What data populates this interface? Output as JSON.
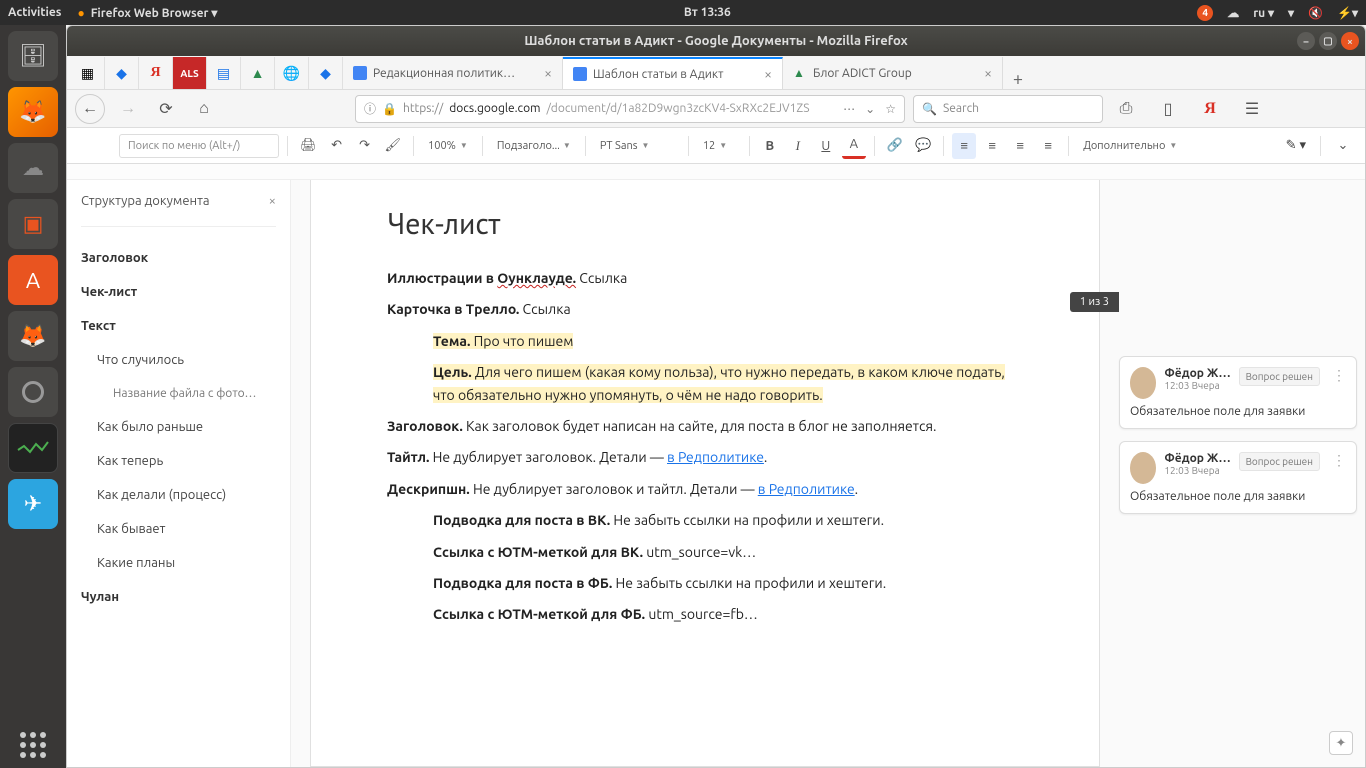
{
  "ubuntu": {
    "activities": "Activities",
    "app_menu": "Firefox Web Browser ▾",
    "clock": "Вт 13:36",
    "notif_count": "4",
    "lang": "ru ▾"
  },
  "launcher": {
    "items": [
      "Files",
      "Firefox",
      "Nextcloud",
      "Sublime Text",
      "Ubuntu Software",
      "GIMP",
      "Settings",
      "System Monitor",
      "Telegram"
    ]
  },
  "window": {
    "title": "Шаблон статьи в Адикт - Google Документы - Mozilla Firefox"
  },
  "tabs": {
    "pinned_count": 8,
    "items": [
      {
        "label": "Редакционная политик…",
        "active": false,
        "icon": "docs"
      },
      {
        "label": "Шаблон статьи в Адикт",
        "active": true,
        "icon": "docs"
      },
      {
        "label": "Блог ADICT Group",
        "active": false,
        "icon": "adict"
      }
    ]
  },
  "url": {
    "proto": "https://",
    "host": "docs.google.com",
    "path": "/document/d/1a82D9wgn3zcKV4-SxRXc2EJV1ZS"
  },
  "search": {
    "placeholder": "Search"
  },
  "toolbar": {
    "menu_search": "Поиск по меню (Alt+/)",
    "zoom": "100%",
    "style": "Подзаголо...",
    "font": "PT Sans",
    "size": "12",
    "more": "Дополнительно"
  },
  "outline": {
    "title": "Структура документа",
    "items": [
      {
        "t": "Заголовок",
        "lvl": "h1"
      },
      {
        "t": "Чек-лист",
        "lvl": "h2"
      },
      {
        "t": "Текст",
        "lvl": "h2"
      },
      {
        "t": "Что случилось",
        "lvl": "h3"
      },
      {
        "t": "Название файла с фото…",
        "lvl": "h4"
      },
      {
        "t": "Как было раньше",
        "lvl": "h3"
      },
      {
        "t": "Как теперь",
        "lvl": "h3"
      },
      {
        "t": "Как делали (процесс)",
        "lvl": "h3"
      },
      {
        "t": "Как бывает",
        "lvl": "h3"
      },
      {
        "t": "Какие планы",
        "lvl": "h3"
      },
      {
        "t": "Чулан",
        "lvl": "h2"
      }
    ]
  },
  "doc": {
    "heading": "Чек-лист",
    "p1_b": "Иллюстрации в ",
    "p1_link": "Оунклауде.",
    "p1_rest": " Ссылка",
    "p2_b": "Карточка в Трелло.",
    "p2_rest": " Ссылка",
    "p3_b": "Тема.",
    "p3_rest": " Про что пишем",
    "p4_b": "Цель.",
    "p4_rest": " Для чего пишем (какая кому польза), что нужно передать, в каком ключе подать, что обязательно нужно упомянуть, о чём не надо говорить.",
    "p5_b": "Заголовок.",
    "p5_rest": " Как заголовок будет написан на сайте, для поста в блог не заполняется.",
    "p6_b": "Тайтл.",
    "p6_rest": " Не дублирует заголовок. Детали — ",
    "p6_link": "в Редполитике",
    "p6_dot": ".",
    "p7_b": "Дескрипшн.",
    "p7_rest": " Не дублирует заголовок и тайтл. Детали — ",
    "p7_link": "в Редполитике",
    "p7_dot": ".",
    "p8_b": "Подводка для поста в ВК.",
    "p8_rest": " Не забыть ссылки на профили и хештеги.",
    "p9_b": "Ссылка с ЮТМ-меткой для ВК.",
    "p9_rest": " utm_source=vk…",
    "p10_b": "Подводка для поста в ФБ.",
    "p10_rest": " Не забыть ссылки на профили и хештеги.",
    "p11_b": "Ссылка с ЮТМ-меткой для ФБ.",
    "p11_rest": " utm_source=fb…"
  },
  "page_indicator": "1 из 3",
  "comments": [
    {
      "name": "Фёдор Ж…",
      "time": "12:03 Вчера",
      "action": "Вопрос решен",
      "body": "Обязательное поле для заявки"
    },
    {
      "name": "Фёдор Ж…",
      "time": "12:03 Вчера",
      "action": "Вопрос решен",
      "body": "Обязательное поле для заявки"
    }
  ]
}
